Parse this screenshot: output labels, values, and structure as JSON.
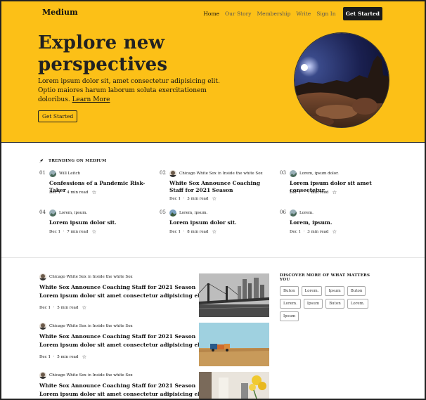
{
  "nav": {
    "brand": "Medium",
    "links": [
      "Home",
      "Our Story",
      "Membership",
      "Write",
      "Sign In"
    ],
    "cta": "Get Started"
  },
  "hero": {
    "title_line1": "Explore new",
    "title_line2": "perspectives",
    "text": "Lorem ipsum dolor sit, amet consectetur adipisicing elit. Optio maiores harum laborum soluta exercitationem doloribus.",
    "link": "Learn More",
    "button": "Get Started"
  },
  "trending": {
    "label": "TRENDING ON MEDIUM",
    "items": [
      {
        "num": "01",
        "author": "Will Leitch",
        "in": "",
        "pub": "",
        "title": "Confessions of a Pandemic Risk-Taker",
        "date": "Dec 1",
        "read": "4 min read"
      },
      {
        "num": "02",
        "author": "Chicago White Sox",
        "in": "in",
        "pub": "Inside the white Sox",
        "title": "White Sox Announce Coaching Staff for 2021 Season",
        "date": "Dec 1",
        "read": "3 min read"
      },
      {
        "num": "03",
        "author": "Lorem, ipsum dolor.",
        "in": "",
        "pub": "",
        "title": "Lorem ipsum dolor sit amet consectetur.",
        "date": "Dec 1",
        "read": "7 min read"
      },
      {
        "num": "04",
        "author": "Lorem, ipsum.",
        "in": "",
        "pub": "",
        "title": "Lorem ipsum dolor sit.",
        "date": "Dec 1",
        "read": "7 min read"
      },
      {
        "num": "05",
        "author": "Lorem, ipsum.",
        "in": "",
        "pub": "",
        "title": "Lorem ipsum dolor sit.",
        "date": "Dec 1",
        "read": "8 min read"
      },
      {
        "num": "06",
        "author": "Lorem.",
        "in": "",
        "pub": "",
        "title": "Lorem, ipsum.",
        "date": "Dec 1",
        "read": "3 min read"
      }
    ]
  },
  "feed": [
    {
      "author": "Chicago White Sox",
      "in": "in",
      "pub": "Inside the white Sox",
      "title": "White Sox Announce Coaching Staff for 2021 Season",
      "subtitle": "Lorem ipsum dolor sit amet consectetur adipisicing elit.",
      "date": "Dec 1",
      "read": "5 min read"
    },
    {
      "author": "Chicago White Sox",
      "in": "in",
      "pub": "Inside the white Sox",
      "title": "White Sox Announce Coaching Staff for 2021 Season",
      "subtitle": "Lorem ipsum dolor sit amet consectetur adipisicing elit.",
      "date": "Dec 1",
      "read": "5 min read"
    },
    {
      "author": "Chicago White Sox",
      "in": "in",
      "pub": "Inside the white Sox",
      "title": "White Sox Announce Coaching Staff for 2021 Season",
      "subtitle": "Lorem ipsum dolor sit amet consectetur adipisicing elit.",
      "date": "",
      "read": ""
    }
  ],
  "discover": {
    "label": "DISCOVER MORE OF WHAT MATTERS YOU",
    "tags": [
      "Buton",
      "Lorem.",
      "Ipsum",
      "Buton",
      "Lorem.",
      "Ipsum",
      "Buton",
      "Lorem.",
      "Ipsum"
    ]
  },
  "colors": {
    "accent": "#fcc017",
    "dark": "#1b1b1b"
  }
}
